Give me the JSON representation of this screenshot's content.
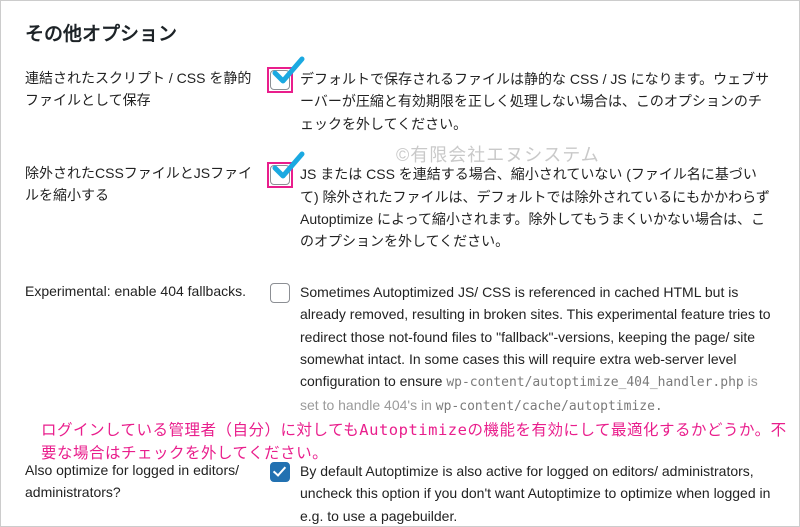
{
  "section_title": "その他オプション",
  "watermark": "©有限会社エヌシステム",
  "options": {
    "save_static": {
      "label": "連結されたスクリプト / CSS を静的ファイルとして保存",
      "desc": "デフォルトで保存されるファイルは静的な CSS / JS になります。ウェブサーバーが圧縮と有効期限を正しく処理しない場合は、このオプションのチェックを外してください。"
    },
    "minify_excluded": {
      "label": "除外されたCSSファイルとJSファイルを縮小する",
      "desc": "JS または CSS を連結する場合、縮小されていない (ファイル名に基づいて) 除外されたファイルは、デフォルトでは除外されているにもかかわらず Autoptimize によって縮小されます。除外してもうまくいかない場合は、このオプションを外してください。"
    },
    "fallback_404": {
      "label": "Experimental: enable 404 fallbacks.",
      "desc_1": "Sometimes Autoptimized JS/ CSS is referenced in cached HTML but is already removed, resulting in broken sites. This experimental feature tries to redirect those not-found files to \"fallback\"-versions, keeping the page/ site somewhat intact. In some cases this will require extra web-server level configuration to ensure ",
      "desc_code1": "wp-content/autoptimize_404_handler.php",
      "desc_2": " is set to handle 404's in ",
      "desc_code2": "wp-content/cache/autoptimize."
    },
    "optimize_admin": {
      "label": "Also optimize for logged in editors/ administrators?",
      "desc": "By default Autoptimize is also active for logged on editors/ administrators, uncheck this option if you don't want Autoptimize to optimize when logged in e.g. to use a pagebuilder."
    }
  },
  "annotation": "ログインしている管理者（自分）に対してもAutoptimizeの機能を有効にして最適化するかどうか。不要な場合はチェックを外してください。"
}
